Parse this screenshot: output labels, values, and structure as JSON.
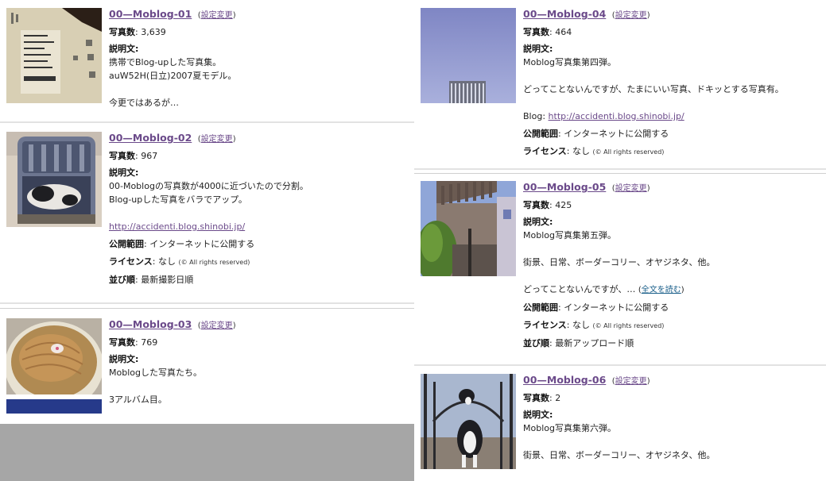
{
  "labels": {
    "count": "写真数",
    "desc": "説明文:",
    "scope": "公開範囲",
    "license": "ライセンス",
    "order": "並び順",
    "settings_open": "(",
    "settings": "設定変更",
    "settings_close": ")",
    "read_more": "全文を読む"
  },
  "albums": [
    {
      "title": "00—Moblog-01",
      "count": ": 3,639",
      "desc": [
        "携帯でBlog-upした写真集。",
        "auW52H(日立)2007夏モデル。",
        "",
        "今更ではあるが…"
      ]
    },
    {
      "title": "00—Moblog-02",
      "count": ": 967",
      "desc": [
        "00-Moblogの写真数が4000に近づいたので分割。",
        "Blog-upした写真をバラでアップ。"
      ],
      "blog": "http://accidenti.blog.shinobi.jp/",
      "scope": ": インターネットに公開する",
      "license": ": なし",
      "rights": "(© All rights reserved)",
      "order": ": 最新撮影日順"
    },
    {
      "title": "00—Moblog-03",
      "count": ": 769",
      "desc": [
        "Moblogした写真たち。",
        "",
        "3アルバム目。"
      ]
    },
    {
      "title": "00—Moblog-04",
      "count": ": 464",
      "desc": [
        "Moblog写真集第四弾。",
        "",
        "どってことないんですが、たまにいい写真、ドキッとする写真有。"
      ],
      "blog_prefix": "Blog: ",
      "blog": "http://accidenti.blog.shinobi.jp/",
      "scope": ": インターネットに公開する",
      "license": ": なし",
      "rights": "(© All rights reserved)"
    },
    {
      "title": "00—Moblog-05",
      "count": ": 425",
      "desc": [
        "Moblog写真集第五弾。",
        "",
        "街景、日常、ボーダーコリー、オヤジネタ、他。",
        ""
      ],
      "desc_tail": "どってことないんですが、… ",
      "scope": ": インターネットに公開する",
      "license": ": なし",
      "rights": "(© All rights reserved)",
      "order": ": 最新アップロード順"
    },
    {
      "title": "00—Moblog-06",
      "count": ": 2",
      "desc": [
        "Moblog写真集第六弾。",
        "",
        "街景、日常、ボーダーコリー、オヤジネタ、他。"
      ]
    }
  ]
}
